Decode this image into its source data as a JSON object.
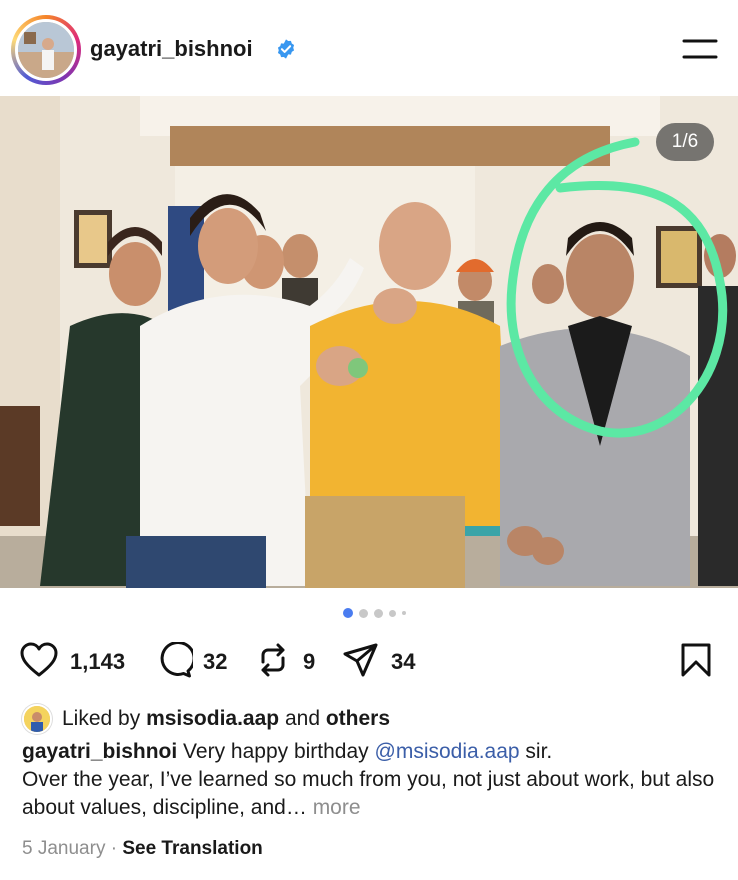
{
  "post": {
    "username": "gayatri_bishnoi",
    "photo_counter": "1/6",
    "carousel_dots": 5,
    "carousel_active": 0,
    "likes": "1,143",
    "comments": "32",
    "reposts": "9",
    "shares": "34",
    "liked_prefix": "Liked by",
    "liked_user": "msisodia.aap",
    "liked_conj": "and",
    "liked_others": "others",
    "caption_user": "gayatri_bishnoi",
    "caption_text_1": "Very happy birthday",
    "caption_mention": "@msisodia.aap",
    "caption_text_2": "sir.",
    "caption_text_3": "Over the year, I’ve learned so much from you, not just about work, but also about values, discipline, and…",
    "more_label": "more",
    "date": "5 January",
    "separator": "·",
    "see_translation": "See Translation"
  },
  "colors": {
    "accent_mention": "#3b5ea8",
    "verified_blue": "#3897f0",
    "highlight_circle": "#5ce8a4",
    "dot_active": "#4a7cf0",
    "dot_inactive": "#c8c8c8"
  },
  "icons": {
    "menu": "hamburger-icon",
    "like": "heart-icon",
    "comment": "comment-icon",
    "repost": "repost-icon",
    "share": "send-icon",
    "save": "bookmark-icon",
    "verified": "verified-badge-icon"
  }
}
